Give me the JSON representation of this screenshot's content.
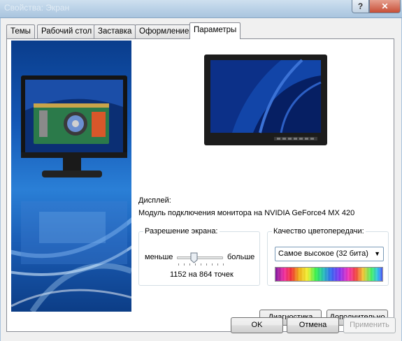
{
  "window": {
    "title": "Свойства: Экран",
    "help_label": "?",
    "close_label": "✕"
  },
  "tabs": [
    {
      "label": "Темы"
    },
    {
      "label": "Рабочий стол"
    },
    {
      "label": "Заставка"
    },
    {
      "label": "Оформление"
    },
    {
      "label": "Параметры",
      "active": true
    }
  ],
  "display": {
    "label": "Дисплей:",
    "device": "Модуль подключения монитора на NVIDIA GeForce4 MX 420"
  },
  "resolution": {
    "title": "Разрешение экрана:",
    "less_label": "меньше",
    "more_label": "больше",
    "value_text": "1152 на 864 точек",
    "slider_level": 0.5
  },
  "color_quality": {
    "title": "Качество цветопередачи:",
    "selected": "Самое высокое (32 бита)"
  },
  "buttons": {
    "troubleshoot": "Диагностика",
    "advanced": "Дополнительно",
    "ok": "OK",
    "cancel": "Отмена",
    "apply": "Применить"
  },
  "colors": {
    "accent": "#1357b5",
    "title_bar": "#bcd3e8"
  }
}
